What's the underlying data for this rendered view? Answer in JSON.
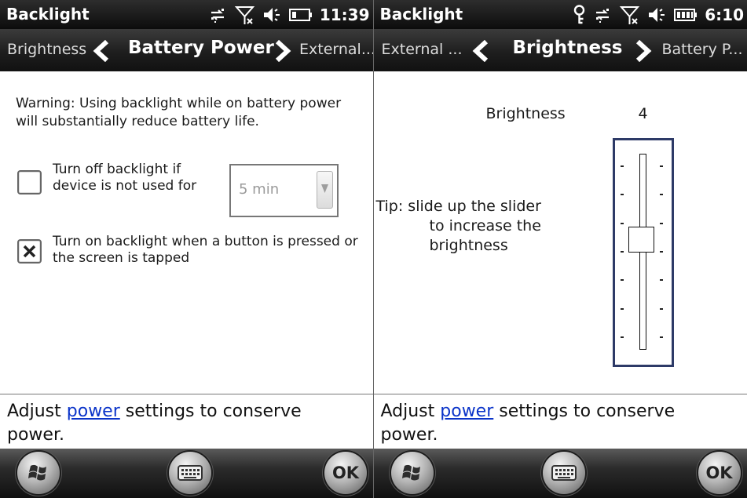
{
  "screens": {
    "left": {
      "app_title": "Backlight",
      "clock": "11:39",
      "status_icons": [
        "sync-icon",
        "signal-off-icon",
        "speaker-icon",
        "battery-icon"
      ],
      "tabs": {
        "prev": "Brightness",
        "current": "Battery Power",
        "next": "External..."
      },
      "warning": "Warning: Using backlight while on battery power will substantially reduce battery life.",
      "option1": {
        "checked": false,
        "label": "Turn off backlight if device is not used for"
      },
      "timeout_select": {
        "value": "5 min"
      },
      "option2": {
        "checked": true,
        "label": "Turn on backlight when a button is pressed or the screen is tapped"
      },
      "footer": {
        "before": "Adjust ",
        "link": "power",
        "after": " settings to conserve power."
      },
      "menu": {
        "left_icon": "start-windows-icon",
        "center_icon": "keyboard-icon",
        "ok": "OK"
      }
    },
    "right": {
      "app_title": "Backlight",
      "clock": "6:10",
      "status_icons": [
        "bluetooth-or-key-icon",
        "sync-icon",
        "signal-off-icon",
        "speaker-icon",
        "battery-icon"
      ],
      "tabs": {
        "prev": "External ...",
        "current": "Brightness",
        "next": "Battery P..."
      },
      "brightness_label": "Brightness",
      "brightness_value": "4",
      "tip": [
        "Tip: slide up the slider",
        "to increase the",
        "brightness"
      ],
      "slider": {
        "level": 4,
        "max": 7,
        "ticks": 7
      },
      "footer": {
        "before": "Adjust ",
        "link": "power",
        "after": " settings to conserve power."
      },
      "menu": {
        "left_icon": "start-windows-icon",
        "center_icon": "keyboard-icon",
        "ok": "OK"
      }
    }
  },
  "colors": {
    "link": "#0b34c9",
    "slider_frame": "#2d3a67",
    "chrome": "#161616"
  }
}
